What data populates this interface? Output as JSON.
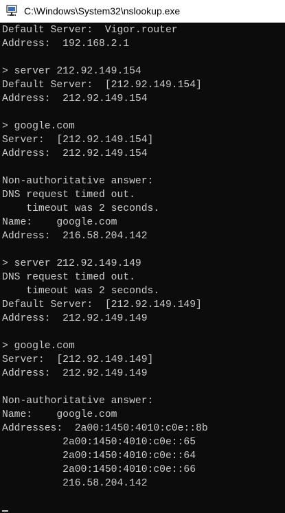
{
  "window": {
    "title": "C:\\Windows\\System32\\nslookup.exe",
    "icon": "nslookup-app-icon"
  },
  "console": {
    "lines": [
      "Default Server:  Vigor.router",
      "Address:  192.168.2.1",
      "",
      "> server 212.92.149.154",
      "Default Server:  [212.92.149.154]",
      "Address:  212.92.149.154",
      "",
      "> google.com",
      "Server:  [212.92.149.154]",
      "Address:  212.92.149.154",
      "",
      "Non-authoritative answer:",
      "DNS request timed out.",
      "    timeout was 2 seconds.",
      "Name:    google.com",
      "Address:  216.58.204.142",
      "",
      "> server 212.92.149.149",
      "DNS request timed out.",
      "    timeout was 2 seconds.",
      "Default Server:  [212.92.149.149]",
      "Address:  212.92.149.149",
      "",
      "> google.com",
      "Server:  [212.92.149.149]",
      "Address:  212.92.149.149",
      "",
      "Non-authoritative answer:",
      "Name:    google.com",
      "Addresses:  2a00:1450:4010:c0e::8b",
      "          2a00:1450:4010:c0e::65",
      "          2a00:1450:4010:c0e::64",
      "          2a00:1450:4010:c0e::66",
      "          216.58.204.142"
    ]
  },
  "colors": {
    "console_background": "#0c0c0c",
    "console_text": "#cccccc",
    "titlebar_background": "#ffffff"
  }
}
